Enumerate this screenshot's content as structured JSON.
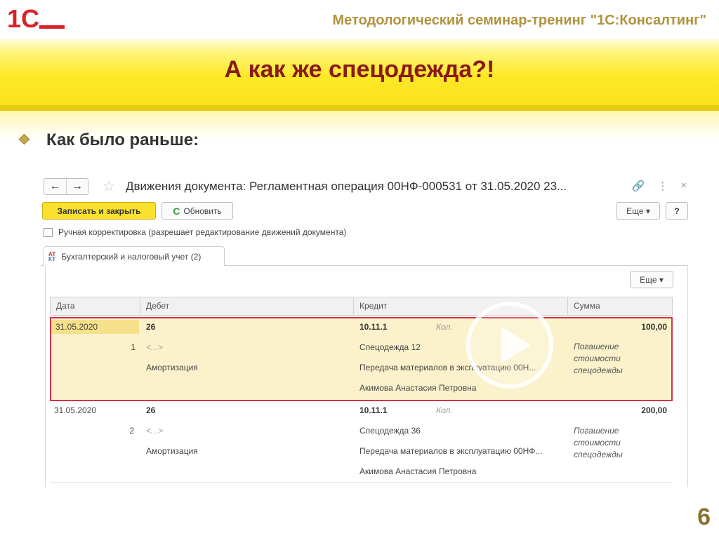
{
  "header": {
    "logo_text": "1С",
    "seminar": "Методологический семинар-тренинг \"1С:Консалтинг\"",
    "title": "А как же спецодежда?!",
    "bullet": "Как было раньше:",
    "page_number": "6"
  },
  "form": {
    "nav_back": "←",
    "nav_forward": "→",
    "title": "Движения документа: Регламентная операция 00НФ-000531 от 31.05.2020 23...",
    "win_icons": {
      "link": "🔗",
      "menu": "⋮",
      "close": "×"
    },
    "buttons": {
      "save_close": "Записать и закрыть",
      "refresh_icon": "C",
      "refresh": "Обновить",
      "more": "Еще ▾",
      "help": "?",
      "more_table": "Еще ▾"
    },
    "manual_checkbox": {
      "label": "Ручная корректировка (разрешает редактирование движений документа)",
      "checked": false
    },
    "tab": {
      "icon_top": "АТ",
      "icon_bottom": "КТ",
      "label": "Бухгалтерский и налоговый учет (2)"
    },
    "table": {
      "columns": [
        "Дата",
        "Дебет",
        "Кредит",
        "Сумма"
      ],
      "rows": [
        {
          "date": "31.05.2020",
          "number": "1",
          "debit_account": "26",
          "debit_subconto1": "<...>",
          "debit_subconto2": "Амортизация",
          "credit_account": "10.11.1",
          "qty_label": "Кол.",
          "credit_subconto1": "Спецодежда 12",
          "credit_subconto2": "Передача материалов в эксплуатацию 00Н...",
          "credit_subconto3": "Акимова Анастасия Петровна",
          "amount": "100,00",
          "content": [
            "Погашение",
            "стоимости",
            "спецодежды"
          ]
        },
        {
          "date": "31.05.2020",
          "number": "2",
          "debit_account": "26",
          "debit_subconto1": "<...>",
          "debit_subconto2": "Амортизация",
          "credit_account": "10.11.1",
          "qty_label": "Кол.",
          "credit_subconto1": "Спецодежда 36",
          "credit_subconto2": "Передача материалов в эксплуатацию 00НФ...",
          "credit_subconto3": "Акимова Анастасия Петровна",
          "amount": "200,00",
          "content": [
            "Погашение",
            "стоимости",
            "спецодежды"
          ]
        }
      ]
    }
  },
  "colors": {
    "title": "#8b1a1a",
    "band_yellow": "#fbe11b",
    "primary_button": "#fbe12e",
    "selection_border": "#d0344b",
    "selection_fill": "#fbf2cc"
  }
}
